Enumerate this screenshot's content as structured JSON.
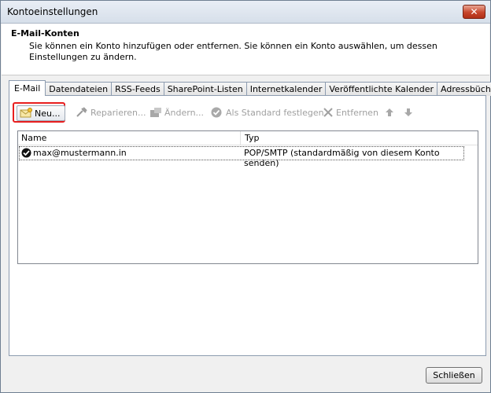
{
  "window": {
    "title": "Kontoeinstellungen",
    "close_glyph": "✕"
  },
  "header": {
    "title": "E-Mail-Konten",
    "description": "Sie können ein Konto hinzufügen oder entfernen. Sie können ein Konto auswählen, um dessen Einstellungen zu ändern."
  },
  "tabs": [
    {
      "label": "E-Mail",
      "active": true
    },
    {
      "label": "Datendateien"
    },
    {
      "label": "RSS-Feeds"
    },
    {
      "label": "SharePoint-Listen"
    },
    {
      "label": "Internetkalender"
    },
    {
      "label": "Veröffentlichte Kalender"
    },
    {
      "label": "Adressbücher"
    }
  ],
  "toolbar": {
    "new_label": "Neu...",
    "repair_label": "Reparieren...",
    "change_label": "Ändern...",
    "default_label": "Als Standard festlegen",
    "remove_label": "Entfernen"
  },
  "accounts": {
    "columns": {
      "name": "Name",
      "type": "Typ"
    },
    "rows": [
      {
        "name": "max@mustermann.in",
        "type": "POP/SMTP (standardmäßig von diesem Konto senden)"
      }
    ]
  },
  "footer": {
    "close_label": "Schließen"
  },
  "colors": {
    "highlight": "#e81e1e",
    "disabled_text": "#a0a0a0"
  }
}
